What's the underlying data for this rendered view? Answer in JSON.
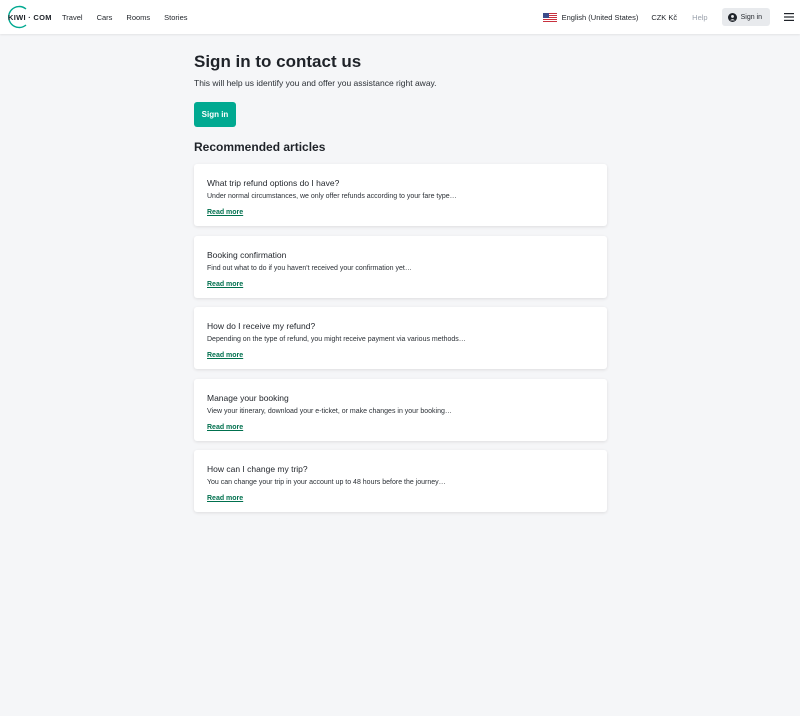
{
  "header": {
    "logo_text": "KIWI · COM",
    "nav": [
      "Travel",
      "Cars",
      "Rooms",
      "Stories"
    ],
    "language": "English (United States)",
    "currency": "CZK Kč",
    "help": "Help",
    "signin": "Sign in",
    "flag_icon": "us-flag-icon",
    "user_icon": "user-icon",
    "menu_icon": "hamburger-menu-icon"
  },
  "main": {
    "title": "Sign in to contact us",
    "subtitle": "This will help us identify you and offer you assistance right away.",
    "signin_button": "Sign in",
    "section_title": "Recommended articles",
    "read_more": "Read more",
    "articles": [
      {
        "title": "What trip refund options do I have?",
        "desc": "Under normal circumstances, we only offer refunds according to your fare type…"
      },
      {
        "title": "Booking confirmation",
        "desc": "Find out what to do if you haven't received your confirmation yet…"
      },
      {
        "title": "How do I receive my refund?",
        "desc": "Depending on the type of refund, you might receive payment via various methods…"
      },
      {
        "title": "Manage your booking",
        "desc": "View your itinerary, download your e-ticket, or make changes in your booking…"
      },
      {
        "title": "How can I change my trip?",
        "desc": "You can change your trip in your account up to 48 hours before the journey…"
      }
    ]
  },
  "colors": {
    "accent": "#00a991",
    "link": "#00704e",
    "background": "#f5f6f8"
  }
}
